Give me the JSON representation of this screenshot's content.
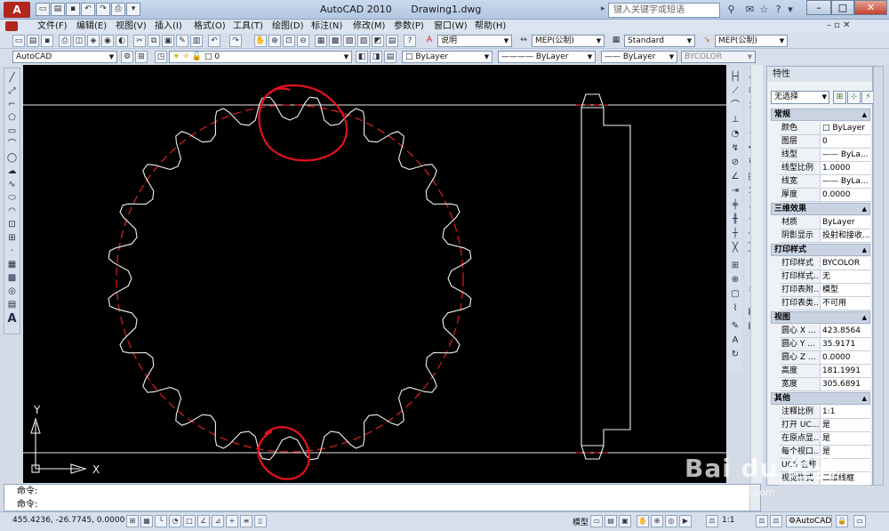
{
  "app": {
    "logo": "A",
    "title": "AutoCAD 2010",
    "document": "Drawing1.dwg"
  },
  "search": {
    "placeholder": "键入关键字或短语"
  },
  "window_controls": {
    "minimize": "–",
    "maximize": "□",
    "close": "✕"
  },
  "menu": [
    "文件(F)",
    "编辑(E)",
    "视图(V)",
    "插入(I)",
    "格式(O)",
    "工具(T)",
    "绘图(D)",
    "标注(N)",
    "修改(M)",
    "参数(P)",
    "窗口(W)",
    "帮助(H)"
  ],
  "toolbar1": {
    "text_style": "说明",
    "dim_style": "MEP(公制)",
    "table_style": "Standard",
    "multileader_style": "MEP(公制)"
  },
  "toolbar2": {
    "workspace": "AutoCAD",
    "layer": "0",
    "color": "ByLayer",
    "linetype": "ByLayer",
    "lineweight": "ByLayer",
    "plotstyle": "BYCOLOR"
  },
  "ucs": {
    "x_label": "X",
    "y_label": "Y"
  },
  "properties": {
    "title": "特性",
    "selection": "无选择",
    "sections": [
      {
        "name": "常规",
        "rows": [
          {
            "key": "颜色",
            "value": "□ ByLayer"
          },
          {
            "key": "图层",
            "value": "0"
          },
          {
            "key": "线型",
            "value": "—— ByLa..."
          },
          {
            "key": "线型比例",
            "value": "1.0000"
          },
          {
            "key": "线宽",
            "value": "—— ByLa..."
          },
          {
            "key": "厚度",
            "value": "0.0000"
          }
        ]
      },
      {
        "name": "三维效果",
        "rows": [
          {
            "key": "材质",
            "value": "ByLayer"
          },
          {
            "key": "阴影显示",
            "value": "投射和接收..."
          }
        ]
      },
      {
        "name": "打印样式",
        "rows": [
          {
            "key": "打印样式",
            "value": "BYCOLOR"
          },
          {
            "key": "打印样式...",
            "value": "无"
          },
          {
            "key": "打印表附...",
            "value": "模型"
          },
          {
            "key": "打印表类...",
            "value": "不可用"
          }
        ]
      },
      {
        "name": "视图",
        "rows": [
          {
            "key": "圆心 X ...",
            "value": "423.8564"
          },
          {
            "key": "圆心 Y ...",
            "value": "35.9171"
          },
          {
            "key": "圆心 Z ...",
            "value": "0.0000"
          },
          {
            "key": "高度",
            "value": "181.1991"
          },
          {
            "key": "宽度",
            "value": "305.6891"
          }
        ]
      },
      {
        "name": "其他",
        "rows": [
          {
            "key": "注释比例",
            "value": "1:1"
          },
          {
            "key": "打开 UC...",
            "value": "是"
          },
          {
            "key": "在原点显...",
            "value": "是"
          },
          {
            "key": "每个视口...",
            "value": "是"
          },
          {
            "key": "UCS 名称",
            "value": ""
          },
          {
            "key": "视觉样式",
            "value": "二维线框"
          }
        ]
      }
    ]
  },
  "command": {
    "line1": "命令:",
    "line2": "命令:"
  },
  "status": {
    "coordinates": "455.4236, -26.7745, 0.0000",
    "model": "模型",
    "scale": "1:1",
    "workspace": "AutoCAD"
  },
  "watermark": {
    "brand": "Bai du 经验",
    "url": "jingyan.baidu.com"
  },
  "colors": {
    "canvas": "#000000",
    "geometry": "#ffffff",
    "pitch_circle": "#e02020",
    "annotation": "#e8101e"
  }
}
